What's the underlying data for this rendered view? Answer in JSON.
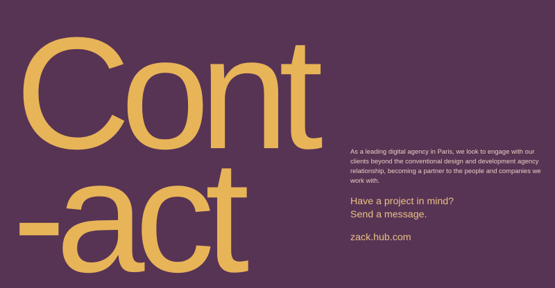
{
  "hero": {
    "line1": "Cont",
    "line2": "-act"
  },
  "intro": {
    "text": "As a leading digital agency in Paris, we look to engage with our clients beyond the conventional design and development agency relationship, becoming a partner to the people and companies we work with."
  },
  "cta": {
    "line1": "Have a project in mind?",
    "line2": "Send a message."
  },
  "contact": {
    "email": "zack.hub.com"
  },
  "colors": {
    "background": "#573454",
    "accent": "#E8B458",
    "body_text": "#E7CFC3"
  }
}
